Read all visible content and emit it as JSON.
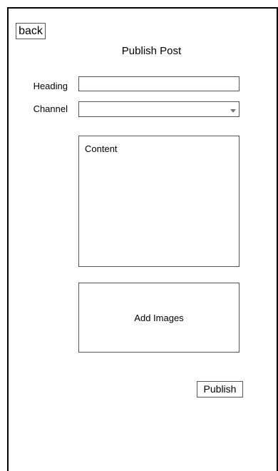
{
  "header": {
    "back_label": "back",
    "title": "Publish Post"
  },
  "form": {
    "heading_label": "Heading",
    "heading_value": "",
    "channel_label": "Channel",
    "channel_value": "",
    "content_placeholder": "Content",
    "add_images_label": "Add Images",
    "publish_label": "Publish"
  },
  "colors": {
    "border": "#555555",
    "frame": "#000000",
    "background": "#ffffff"
  },
  "icons": {
    "channel_dropdown": "chevron-down-icon"
  }
}
